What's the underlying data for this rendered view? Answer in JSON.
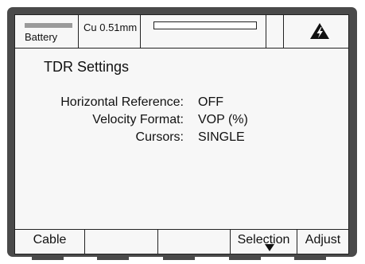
{
  "status_bar": {
    "battery_label": "Battery",
    "cable_type": "Cu 0.51mm",
    "progress_fraction": 0,
    "warning_icon": "high-voltage-warning-icon"
  },
  "screen": {
    "title": "TDR Settings",
    "settings": [
      {
        "label": "Horizontal Reference:",
        "value": "OFF"
      },
      {
        "label": "Velocity Format:",
        "value": "VOP (%)"
      },
      {
        "label": "Cursors:",
        "value": "SINGLE"
      }
    ]
  },
  "softkeys": [
    {
      "label": "Cable"
    },
    {
      "label": ""
    },
    {
      "label": ""
    },
    {
      "label": "Selection",
      "icon": "down-arrow-icon"
    },
    {
      "label": "Adjust"
    }
  ],
  "colors": {
    "bezel": "#4a4a4a",
    "screen": "#f7f7f7",
    "battery": "#9a9a9a"
  }
}
